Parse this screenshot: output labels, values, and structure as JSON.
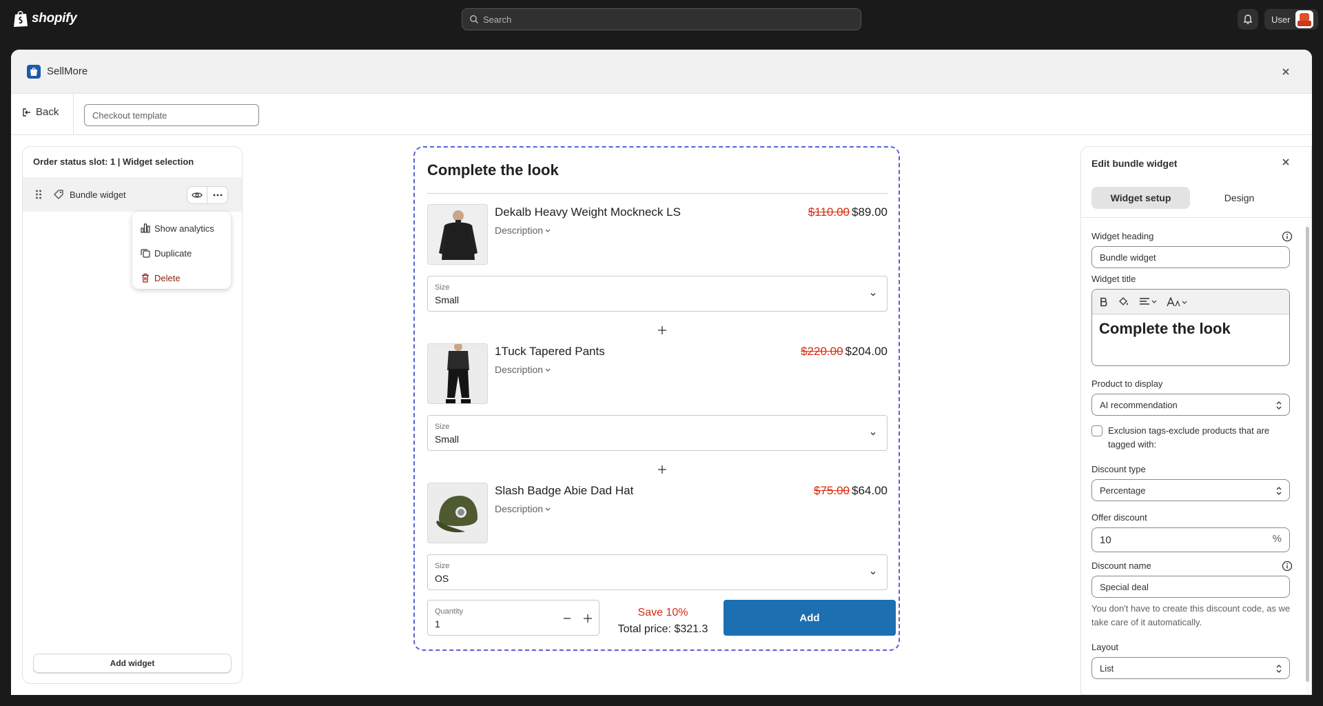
{
  "topbar": {
    "logo_text": "shopify",
    "search_placeholder": "Search",
    "user_name": "User"
  },
  "modal": {
    "app_name": "SellMore",
    "back_label": "Back",
    "template_placeholder": "Checkout template"
  },
  "left_panel": {
    "title": "Order status slot: 1 | Widget selection",
    "widget_label": "Bundle widget",
    "menu": [
      {
        "label": "Show analytics",
        "icon": "bar-chart-icon"
      },
      {
        "label": "Duplicate",
        "icon": "duplicate-icon"
      },
      {
        "label": "Delete",
        "icon": "trash-icon"
      }
    ],
    "add_widget_label": "Add widget"
  },
  "preview": {
    "title": "Complete the look",
    "products": [
      {
        "name": "Dekalb Heavy Weight Mockneck LS",
        "description": "Description",
        "old_price": "$110.00",
        "new_price": "$89.00",
        "size_label": "Size",
        "size_value": "Small"
      },
      {
        "name": "1Tuck Tapered Pants",
        "description": "Description",
        "old_price": "$220.00",
        "new_price": "$204.00",
        "size_label": "Size",
        "size_value": "Small"
      },
      {
        "name": "Slash Badge Abie Dad Hat",
        "description": "Description",
        "old_price": "$75.00",
        "new_price": "$64.00",
        "size_label": "Size",
        "size_value": "OS"
      }
    ],
    "quantity_label": "Quantity",
    "quantity_value": "1",
    "save_text": "Save 10%",
    "total_text": "Total price: $321.3",
    "add_label": "Add"
  },
  "right_panel": {
    "title": "Edit bundle widget",
    "tabs": [
      "Widget setup",
      "Design"
    ],
    "widget_heading_label": "Widget heading",
    "widget_heading_value": "Bundle widget",
    "widget_title_label": "Widget title",
    "widget_title_value": "Complete the look",
    "product_display_label": "Product to display",
    "product_display_value": "AI recommendation",
    "exclusion_label": "Exclusion tags-exclude products that are tagged with:",
    "discount_type_label": "Discount type",
    "discount_type_value": "Percentage",
    "offer_discount_label": "Offer discount",
    "offer_discount_value": "10",
    "offer_discount_suffix": "%",
    "discount_name_label": "Discount name",
    "discount_name_value": "Special deal",
    "discount_help": "You don't have to create this discount code, as we take care of it automatically.",
    "layout_label": "Layout",
    "layout_value": "List"
  },
  "colors": {
    "topbar_bg": "#1a1a1a",
    "primary_button": "#1c6fb1",
    "strike_price": "#d72c0d",
    "preview_border": "#5a5fd6",
    "danger_text": "#8e1f0b"
  }
}
